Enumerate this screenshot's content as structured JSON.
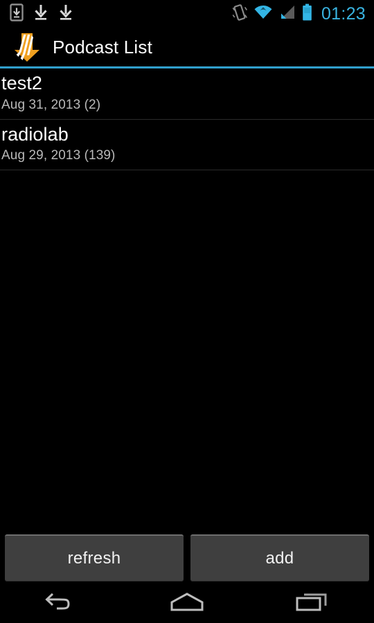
{
  "status_bar": {
    "notifications": [
      {
        "name": "device-download-icon",
        "label": "device download"
      },
      {
        "name": "download-icon",
        "label": "download"
      },
      {
        "name": "download-icon",
        "label": "download"
      }
    ],
    "system_icons": [
      {
        "name": "vibrate-icon",
        "label": "vibrate"
      },
      {
        "name": "wifi-icon",
        "label": "wifi"
      },
      {
        "name": "cellular-signal-icon",
        "label": "cellular signal"
      },
      {
        "name": "battery-icon",
        "label": "battery"
      }
    ],
    "clock": "01:23",
    "colors": {
      "accent": "#33b5e5",
      "icon_inactive": "#8a8a8a"
    }
  },
  "action_bar": {
    "title": "Podcast List",
    "logo_name": "podcast-download-logo",
    "logo_colors": {
      "arrow": "#f0a020",
      "arrow_dark": "#d08010",
      "stripes": "#ffffff"
    },
    "underline_color": "#33b5e5"
  },
  "list": {
    "items": [
      {
        "title": "test2",
        "subtitle": "Aug 31, 2013 (2)",
        "date": "Aug 31, 2013",
        "count": 2
      },
      {
        "title": "radiolab",
        "subtitle": "Aug 29, 2013 (139)",
        "date": "Aug 29, 2013",
        "count": 139
      }
    ]
  },
  "buttons": {
    "refresh_label": "refresh",
    "add_label": "add"
  },
  "nav_bar": {
    "back_label": "Back",
    "home_label": "Home",
    "recents_label": "Recent apps"
  }
}
